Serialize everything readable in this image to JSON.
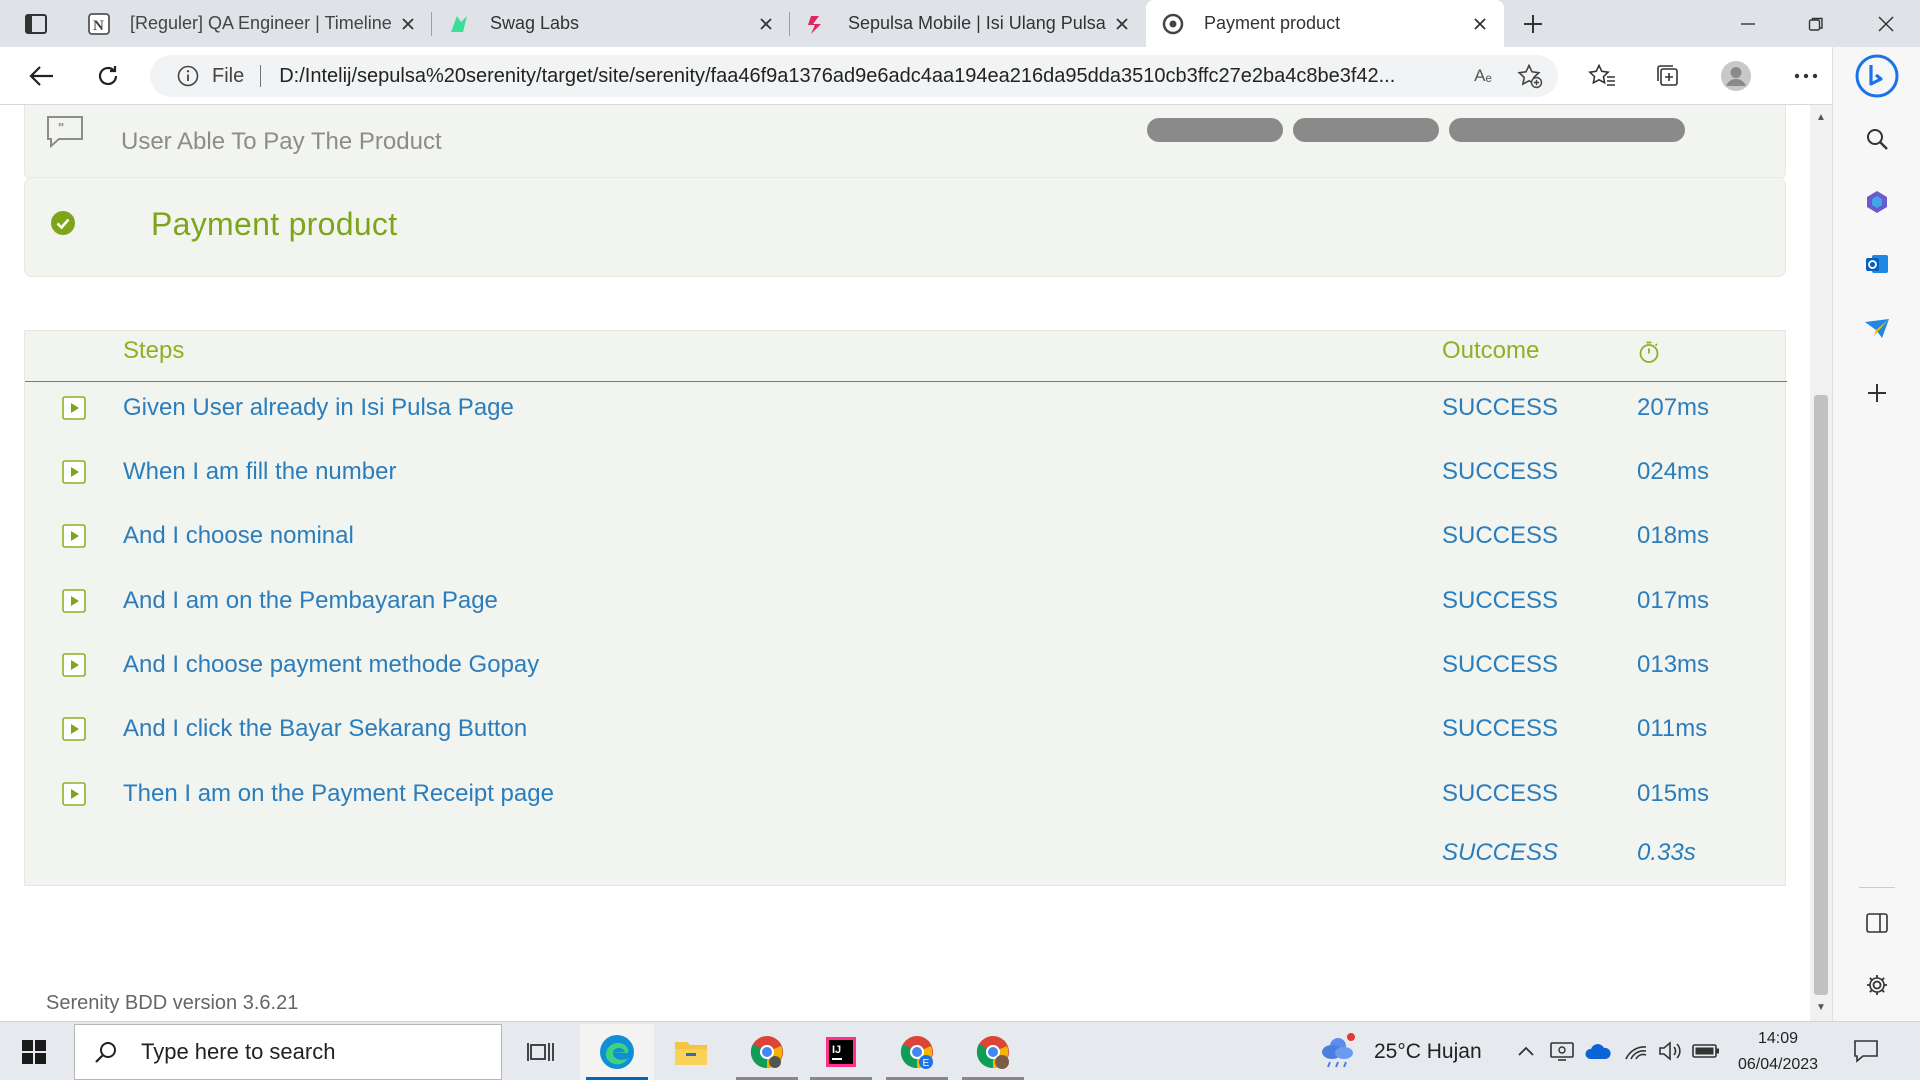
{
  "browser": {
    "tabs": [
      {
        "title": "[Reguler] QA Engineer | Timeline",
        "icon": "notion-icon",
        "active": false
      },
      {
        "title": "Swag Labs",
        "icon": "swag-labs-icon",
        "active": false
      },
      {
        "title": "Sepulsa Mobile | Isi Ulang Pulsa Secara Online",
        "icon": "sepulsa-icon",
        "active": false
      },
      {
        "title": "Payment product",
        "icon": "serenity-icon",
        "active": true
      }
    ],
    "address": {
      "scheme_label": "File",
      "url": "D:/Intelij/sepulsa%20serenity/target/site/serenity/faa46f9a1376ad9e6adc4aa194ea216da95dda3510cb3ffc27e2ba4c8be3f42..."
    },
    "read_aloud": "Aₑ"
  },
  "report": {
    "story_title": "User Able To Pay The Product",
    "scenario": {
      "title": "Payment product",
      "status": "success"
    },
    "table": {
      "col_steps": "Steps",
      "col_outcome": "Outcome",
      "rows": [
        {
          "step": "Given User already in Isi Pulsa Page",
          "outcome": "SUCCESS",
          "duration": "207ms"
        },
        {
          "step": "When I am fill the number",
          "outcome": "SUCCESS",
          "duration": "024ms"
        },
        {
          "step": "And I choose nominal",
          "outcome": "SUCCESS",
          "duration": "018ms"
        },
        {
          "step": "And I am on the Pembayaran Page",
          "outcome": "SUCCESS",
          "duration": "017ms"
        },
        {
          "step": "And I choose payment methode Gopay",
          "outcome": "SUCCESS",
          "duration": "013ms"
        },
        {
          "step": "And I click the Bayar Sekarang Button",
          "outcome": "SUCCESS",
          "duration": "011ms"
        },
        {
          "step": "Then I am on the Payment Receipt page",
          "outcome": "SUCCESS",
          "duration": "015ms"
        }
      ],
      "total": {
        "outcome": "SUCCESS",
        "duration": "0.33s"
      }
    },
    "footer": "Serenity BDD version 3.6.21",
    "colors": {
      "success_green": "#7ca51c",
      "step_blue": "#2b7dbc",
      "panel_bg": "#f2f4ef"
    }
  },
  "taskbar": {
    "search_placeholder": "Type here to search",
    "weather": "25°C  Hujan",
    "time": "14:09",
    "date": "06/04/2023"
  }
}
